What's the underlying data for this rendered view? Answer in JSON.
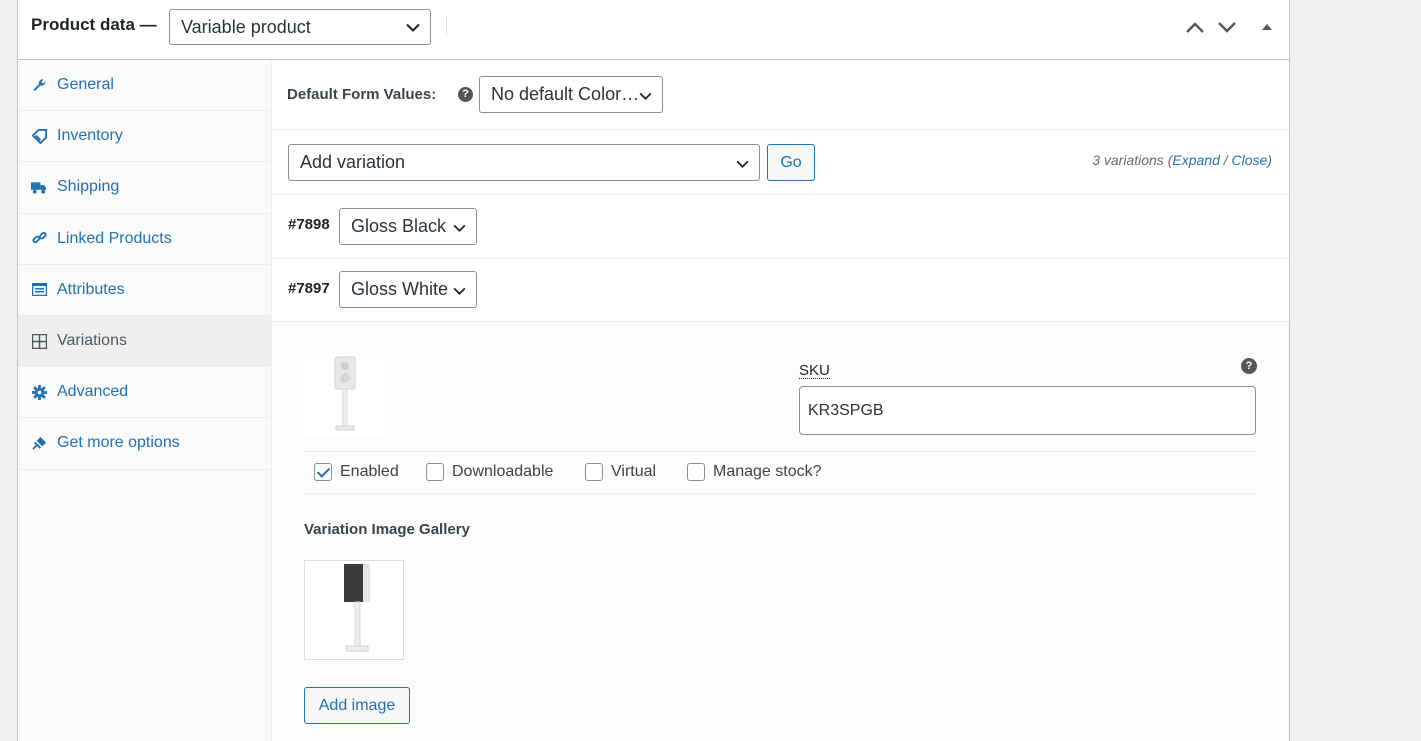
{
  "header": {
    "title": "Product data —",
    "product_type": "Variable product"
  },
  "sidebar": {
    "items": [
      {
        "label": "General",
        "icon": "wrench-icon",
        "active": false
      },
      {
        "label": "Inventory",
        "icon": "tag-icon",
        "active": false
      },
      {
        "label": "Shipping",
        "icon": "truck-icon",
        "active": false
      },
      {
        "label": "Linked Products",
        "icon": "link-icon",
        "active": false
      },
      {
        "label": "Attributes",
        "icon": "list-icon",
        "active": false
      },
      {
        "label": "Variations",
        "icon": "grid-icon",
        "active": true
      },
      {
        "label": "Advanced",
        "icon": "gear-icon",
        "active": false
      },
      {
        "label": "Get more options",
        "icon": "plugin-icon",
        "active": false
      }
    ]
  },
  "main": {
    "default_form": {
      "label": "Default Form Values:",
      "value": "No default Color…"
    },
    "add_variation": {
      "select_value": "Add variation",
      "go_label": "Go"
    },
    "variation_count": {
      "prefix": "3 variations (",
      "expand": "Expand",
      "sep": " / ",
      "close": "Close",
      "suffix": ")"
    },
    "variations": [
      {
        "id": "#7898",
        "color": "Gloss Black"
      },
      {
        "id": "#7897",
        "color": "Gloss White"
      }
    ],
    "expanded": {
      "sku_label": "SKU",
      "sku_value": "KR3SPGB",
      "options": [
        {
          "label": "Enabled",
          "checked": true
        },
        {
          "label": "Downloadable",
          "checked": false
        },
        {
          "label": "Virtual",
          "checked": false
        },
        {
          "label": "Manage stock?",
          "checked": false
        }
      ],
      "gallery_title": "Variation Image Gallery",
      "add_image_label": "Add image"
    }
  },
  "colors": {
    "link": "#2271b1",
    "border": "#c3c4c7",
    "text": "#1d2327"
  }
}
